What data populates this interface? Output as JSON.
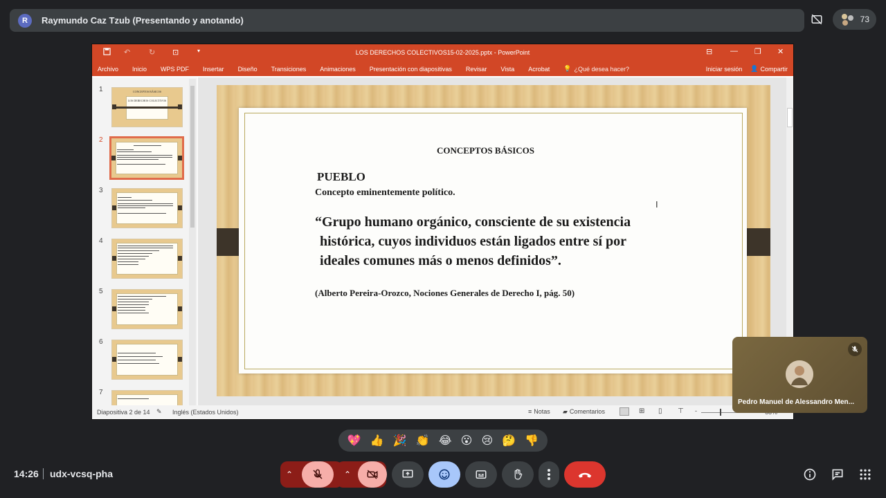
{
  "meet": {
    "presenter_initial": "R",
    "presenter_label": "Raymundo Caz Tzub (Presentando y anotando)",
    "people_count": "73",
    "time": "14:26",
    "meeting_code": "udx-vcsq-pha",
    "participant_name": "Pedro Manuel de Alessandro Men...",
    "reactions": [
      "💖",
      "👍",
      "🎉",
      "👏",
      "😂",
      "😮",
      "😢",
      "🤔",
      "👎"
    ]
  },
  "ppt": {
    "window_title": "LOS DERECHOS COLECTIVOS15-02-2025.pptx - PowerPoint",
    "ribbon_tabs": [
      "Archivo",
      "Inicio",
      "WPS PDF",
      "Insertar",
      "Diseño",
      "Transiciones",
      "Animaciones",
      "Presentación con diapositivas",
      "Revisar",
      "Vista",
      "Acrobat"
    ],
    "tell_me": "¿Qué desea hacer?",
    "sign_in": "Iniciar sesión",
    "share": "Compartir",
    "thumb_numbers": [
      "1",
      "2",
      "3",
      "4",
      "5",
      "6",
      "7"
    ],
    "thumb1_title": "CONCEPTOS BÁSICOS",
    "thumb1_sub": "LOS DERECHOS COLECTIVOS",
    "status": {
      "slide_of": "Diapositiva 2 de 14",
      "language": "Inglés (Estados Unidos)",
      "notes": "Notas",
      "comments": "Comentarios",
      "zoom": "68%"
    }
  },
  "slide": {
    "heading": "CONCEPTOS BÁSICOS",
    "term": "PUEBLO",
    "subtitle": "Concepto eminentemente político.",
    "quote_line1": "“Grupo humano orgánico, consciente de su existencia",
    "quote_line2": "histórica, cuyos individuos están ligados entre sí por",
    "quote_line3": "ideales comunes más o menos definidos”.",
    "citation": "(Alberto Pereira-Orozco, Nociones Generales de Derecho I, pág. 50)"
  }
}
